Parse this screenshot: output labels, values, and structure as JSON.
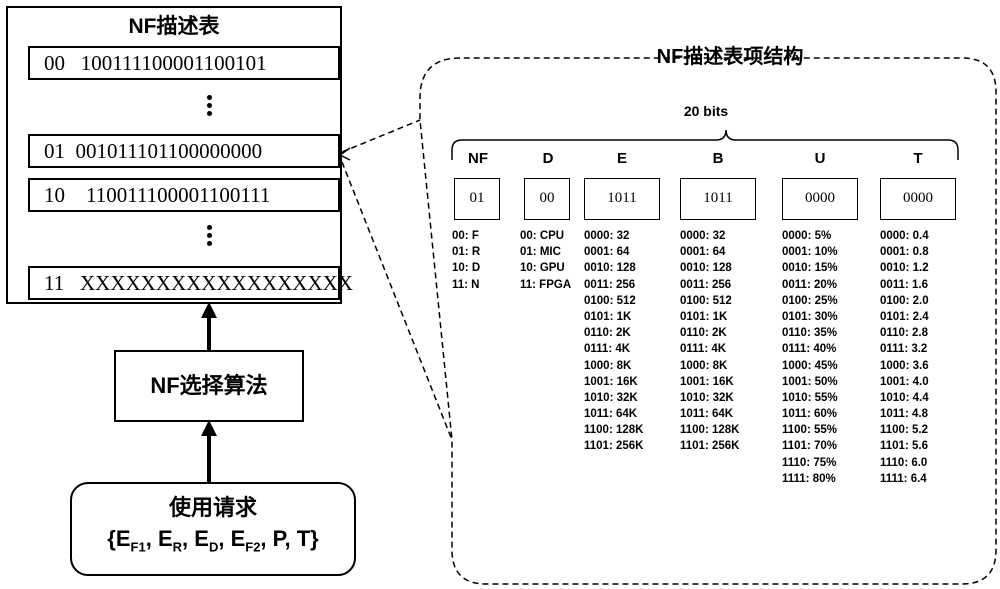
{
  "left_table": {
    "title": "NF描述表",
    "rows": [
      {
        "code": "00",
        "bits": "100111100001100101"
      },
      {
        "code": "01",
        "bits": "001011101100000000"
      },
      {
        "code": "10",
        "bits": "110011100001100111"
      },
      {
        "code": "11",
        "bits": "XXXXXXXXXXXXXXXXXX"
      }
    ]
  },
  "algorithm_box": {
    "label": "NF选择算法"
  },
  "request_box": {
    "title": "使用请求",
    "params_prefix": "{E",
    "params": [
      {
        "base": "E",
        "sub": "F1"
      },
      {
        "base": "E",
        "sub": "R"
      },
      {
        "base": "E",
        "sub": "D"
      },
      {
        "base": "E",
        "sub": "F2"
      },
      {
        "base": "P",
        "sub": ""
      },
      {
        "base": "T",
        "sub": ""
      }
    ]
  },
  "structure_panel": {
    "title": "NF描述表项结构",
    "width_label": "20 bits",
    "fields": [
      {
        "name": "NF",
        "value": "01",
        "options": [
          "00: F",
          "01: R",
          "10: D",
          "11: N"
        ]
      },
      {
        "name": "D",
        "value": "00",
        "options": [
          "00: CPU",
          "01: MIC",
          "10: GPU",
          "11: FPGA"
        ]
      },
      {
        "name": "E",
        "value": "1011",
        "options": [
          "0000: 32",
          "0001: 64",
          "0010: 128",
          "0011: 256",
          "0100: 512",
          "0101: 1K",
          "0110: 2K",
          "0111: 4K",
          "1000: 8K",
          "1001: 16K",
          "1010: 32K",
          "1011: 64K",
          "1100: 128K",
          "1101: 256K"
        ]
      },
      {
        "name": "B",
        "value": "1011",
        "options": [
          "0000: 32",
          "0001: 64",
          "0010: 128",
          "0011: 256",
          "0100: 512",
          "0101: 1K",
          "0110: 2K",
          "0111: 4K",
          "1000: 8K",
          "1001: 16K",
          "1010: 32K",
          "1011: 64K",
          "1100: 128K",
          "1101: 256K"
        ]
      },
      {
        "name": "U",
        "value": "0000",
        "options": [
          "0000: 5%",
          "0001: 10%",
          "0010: 15%",
          "0011: 20%",
          "0100: 25%",
          "0101: 30%",
          "0110: 35%",
          "0111: 40%",
          "1000: 45%",
          "1001: 50%",
          "1010: 55%",
          "1011: 60%",
          "1100: 55%",
          "1101: 70%",
          "1110: 75%",
          "1111: 80%"
        ]
      },
      {
        "name": "T",
        "value": "0000",
        "options": [
          "0000: 0.4",
          "0001: 0.8",
          "0010: 1.2",
          "0011: 1.6",
          "0100: 2.0",
          "0101: 2.4",
          "0110: 2.8",
          "0111: 3.2",
          "1000: 3.6",
          "1001: 4.0",
          "1010: 4.4",
          "1011: 4.8",
          "1100: 5.2",
          "1101: 5.6",
          "1110: 6.0",
          "1111: 6.4"
        ]
      }
    ]
  }
}
